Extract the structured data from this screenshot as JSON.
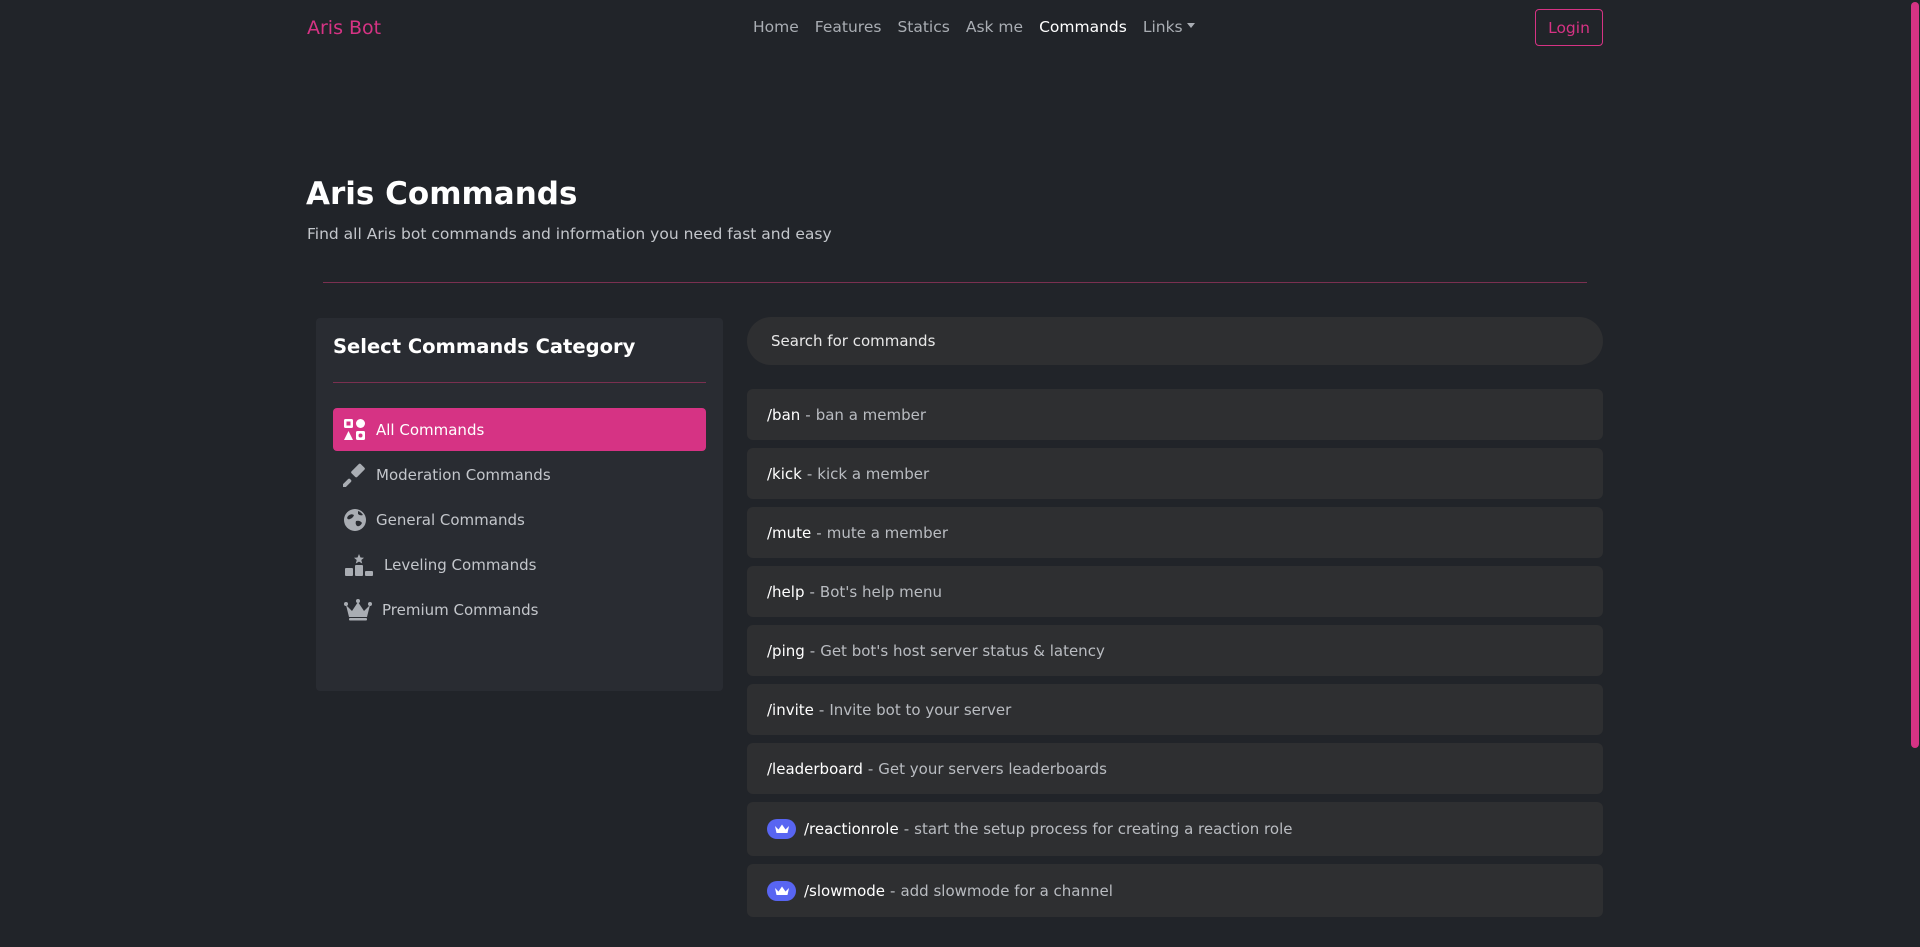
{
  "nav": {
    "brand": "Aris Bot",
    "links": [
      {
        "label": "Home",
        "active": false
      },
      {
        "label": "Features",
        "active": false
      },
      {
        "label": "Statics",
        "active": false
      },
      {
        "label": "Ask me",
        "active": false
      },
      {
        "label": "Commands",
        "active": true
      },
      {
        "label": "Links",
        "active": false,
        "dropdown": true
      }
    ],
    "login_label": "Login"
  },
  "header": {
    "title": "Aris Commands",
    "subtitle": "Find all Aris bot commands and information you need fast and easy"
  },
  "sidebar": {
    "title": "Select Commands Category",
    "categories": [
      {
        "label": "All Commands",
        "icon": "all-commands-icon",
        "active": true
      },
      {
        "label": "Moderation Commands",
        "icon": "gavel-icon",
        "active": false
      },
      {
        "label": "General Commands",
        "icon": "globe-icon",
        "active": false
      },
      {
        "label": "Leveling Commands",
        "icon": "podium-icon",
        "active": false
      },
      {
        "label": "Premium Commands",
        "icon": "crown-icon",
        "active": false
      }
    ]
  },
  "search": {
    "placeholder": "Search for commands"
  },
  "commands": [
    {
      "name": "/ban",
      "description": "ban a member",
      "premium": false
    },
    {
      "name": "/kick",
      "description": "kick a member",
      "premium": false
    },
    {
      "name": "/mute",
      "description": "mute a member",
      "premium": false
    },
    {
      "name": "/help",
      "description": "Bot's help menu",
      "premium": false
    },
    {
      "name": "/ping",
      "description": "Get bot's host server status & latency",
      "premium": false
    },
    {
      "name": "/invite",
      "description": "Invite bot to your server",
      "premium": false
    },
    {
      "name": "/leaderboard",
      "description": "Get your servers leaderboards",
      "premium": false
    },
    {
      "name": "/reactionrole",
      "description": "start the setup process for creating a reaction role",
      "premium": true
    },
    {
      "name": "/slowmode",
      "description": "add slowmode for a channel",
      "premium": true
    }
  ],
  "colors": {
    "background": "#212429",
    "accent": "#d63384",
    "panel": "#292c32",
    "row": "#2e2f31",
    "premium_badge": "#5865f2"
  }
}
